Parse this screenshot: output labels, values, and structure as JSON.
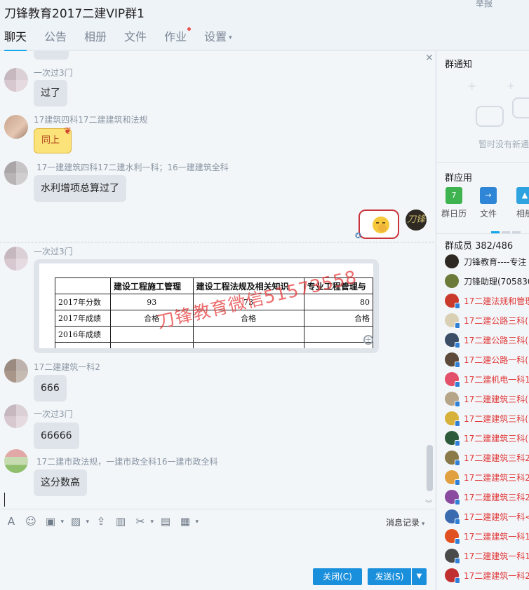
{
  "window": {
    "title": "刀锋教育2017二建VIP群1",
    "report": "举报"
  },
  "tabs": [
    {
      "label": "聊天"
    },
    {
      "label": "公告"
    },
    {
      "label": "相册"
    },
    {
      "label": "文件"
    },
    {
      "label": "作业"
    },
    {
      "label": "设置"
    }
  ],
  "messages": [
    {
      "nick": "一次过3门",
      "text": "过了"
    },
    {
      "nick": "17建筑四科17二建建筑和法规",
      "text": "同上"
    },
    {
      "nick": "17一建建筑四科17二建水利一科；16一建建筑全科",
      "text": "水利增项总算过了"
    },
    {
      "nick": "一次过3门"
    },
    {
      "nick": "17二建建筑一科2",
      "text": "666"
    },
    {
      "nick": "一次过3门",
      "text": "66666"
    },
    {
      "nick": "17二建市政法规，一建市政全科16一建市政全科",
      "text": "这分数高"
    }
  ],
  "self_avatar_text": "刀锋",
  "image_sheet": {
    "headers": [
      "",
      "建设工程施工管理",
      "建设工程法规及相关知识",
      "专业工程管理与"
    ],
    "rows": [
      [
        "2017年分数",
        "93",
        "73",
        "80"
      ],
      [
        "2017年成绩",
        "合格",
        "合格",
        "合格"
      ],
      [
        "2016年成绩",
        "",
        "",
        ""
      ],
      [
        "",
        "",
        "",
        ""
      ]
    ],
    "watermark": "刀锋教育微信51573558"
  },
  "composer": {
    "history": "消息记录",
    "close": "关闭(C)",
    "send": "发送(S)"
  },
  "right_panel": {
    "notice_title": "群通知",
    "notice_empty": "暂时没有新通",
    "apps_title": "群应用",
    "apps": [
      {
        "label": "群日历",
        "icon": "7",
        "color": "#3fb34f"
      },
      {
        "label": "文件",
        "icon": "→",
        "color": "#2f86d6"
      },
      {
        "label": "相册",
        "icon": "▲",
        "color": "#2fa3e0"
      }
    ],
    "members_title": "群成员 382/486",
    "members": [
      {
        "name": "刀锋教育----专注",
        "red": false,
        "color": "#2e2a23"
      },
      {
        "name": "刀锋助理(7058308",
        "red": false,
        "color": "#6c7a3a"
      },
      {
        "name": "17二建法规和管理",
        "red": true,
        "color": "#c93a2c"
      },
      {
        "name": "17二建公路三科(1",
        "red": true,
        "color": "#d9d0b3"
      },
      {
        "name": "17二建公路三科(5",
        "red": true,
        "color": "#3c4e66"
      },
      {
        "name": "17二建公路一科(1",
        "red": true,
        "color": "#5d4a3a"
      },
      {
        "name": "17二建机电一科1(",
        "red": true,
        "color": "#e2506a"
      },
      {
        "name": "17二建建筑三科(3",
        "red": true,
        "color": "#b7a58a"
      },
      {
        "name": "17二建建筑三科(5",
        "red": true,
        "color": "#d6b23a"
      },
      {
        "name": "17二建建筑三科(7",
        "red": true,
        "color": "#2c5a3a"
      },
      {
        "name": "17二建建筑三科2(",
        "red": true,
        "color": "#8a7a4a"
      },
      {
        "name": "17二建建筑三科2(",
        "red": true,
        "color": "#e0a040"
      },
      {
        "name": "17二建建筑三科2(",
        "red": true,
        "color": "#8a4aa0"
      },
      {
        "name": "17二建建筑一科<",
        "red": true,
        "color": "#3a6ab0"
      },
      {
        "name": "17二建建筑一科1(",
        "red": true,
        "color": "#e05020"
      },
      {
        "name": "17二建建筑一科1<",
        "red": true,
        "color": "#4a4a4a"
      },
      {
        "name": "17二建建筑一科2<",
        "red": true,
        "color": "#c03030"
      }
    ]
  }
}
